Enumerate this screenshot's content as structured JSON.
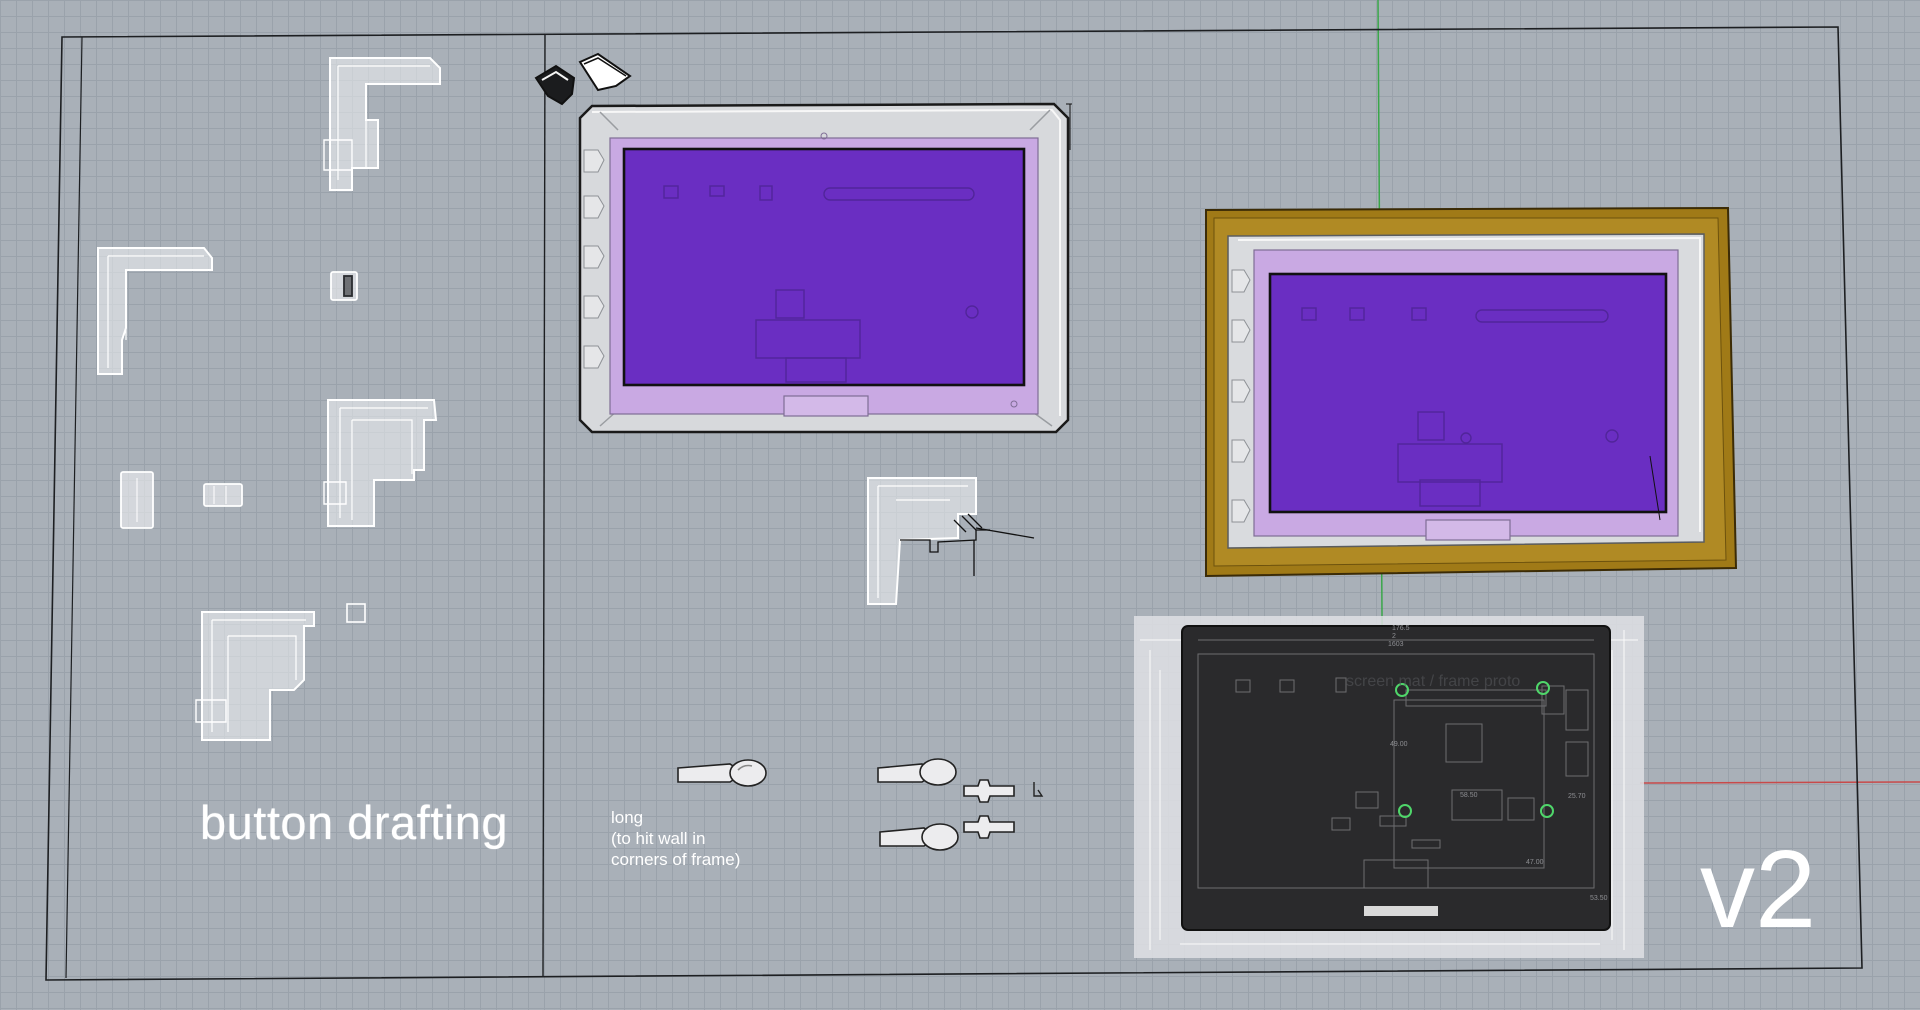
{
  "canvas": {
    "background": "#a9b0b8",
    "grid_color": "#9aa2ab",
    "axis_x_color": "#c84a4a",
    "axis_y_color": "#3aa64a"
  },
  "labels": {
    "title": "button drafting",
    "note_lines": [
      "long",
      "(to hit wall in",
      "corners of frame)"
    ],
    "version": "v2"
  },
  "drawing_overlay": {
    "faint_caption": "screen mat / frame proto",
    "dimensions_top": [
      "176.5",
      "2",
      "1603"
    ],
    "dimensions_inner": [
      "58.50",
      "25.70",
      "49.00",
      "47.00",
      "53.50"
    ],
    "mounting_hole_color": "#4fd66a"
  },
  "colors": {
    "screen_purple": "#6a2ec2",
    "mat_lilac": "#c9a9e3",
    "frame_gold": "#a07a17",
    "pcb_dark": "#2a2a2c",
    "white_part": "#eef0f2"
  },
  "icons": [
    "corner-bracket-icon",
    "clip-icon",
    "button-stem-icon",
    "mounting-hole-icon"
  ]
}
